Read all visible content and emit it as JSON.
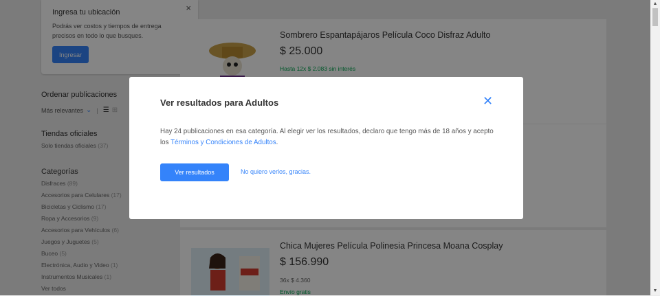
{
  "location_card": {
    "title": "Ingresa tu ubicación",
    "close_icon": "×",
    "text": "Podrás ver costos y tiempos de entrega precisos en todo lo que busques.",
    "button_label": "Ingresar"
  },
  "sidebar": {
    "sort_heading": "Ordenar publicaciones",
    "sort_value": "Más relevantes",
    "stores_heading": "Tiendas oficiales",
    "stores_item": {
      "label": "Solo tiendas oficiales",
      "count": "(37)"
    },
    "categories_heading": "Categorías",
    "categories": [
      {
        "label": "Disfraces",
        "count": "(89)"
      },
      {
        "label": "Accesorios para Celulares",
        "count": "(17)"
      },
      {
        "label": "Bicicletas y Ciclismo",
        "count": "(17)"
      },
      {
        "label": "Ropa y Accesorios",
        "count": "(9)"
      },
      {
        "label": "Accesorios para Vehículos",
        "count": "(6)"
      },
      {
        "label": "Juegos y Juguetes",
        "count": "(5)"
      },
      {
        "label": "Buceo",
        "count": "(5)"
      },
      {
        "label": "Electrónica, Audio y Video",
        "count": "(1)"
      },
      {
        "label": "Instrumentos Musicales",
        "count": "(1)"
      }
    ],
    "see_all": "Ver todos"
  },
  "results": [
    {
      "title": "Sombrero Espantapájaros Película Coco Disfraz Adulto",
      "price": "$ 25.000",
      "sub": "Hasta 12x $ 2.083 sin interés"
    },
    {
      "title": "Chica Mujeres Película Polinesia Princesa Moana Cosplay",
      "price": "$ 156.990",
      "sub": "36x $ 4.360",
      "sub2": "Envío gratis"
    }
  ],
  "modal": {
    "title": "Ver resultados para Adultos",
    "text_before": "Hay 24 publicaciones en esa categoría. Al elegir ver los resultados, declaro que tengo más de 18 años y acepto los ",
    "text_link": "Términos y Condiciones de Adultos",
    "text_after": ".",
    "primary_button": "Ver resultados",
    "secondary_link": "No quiero verlos, gracias."
  },
  "colors": {
    "accent": "#3483fa",
    "green": "#00a650"
  }
}
